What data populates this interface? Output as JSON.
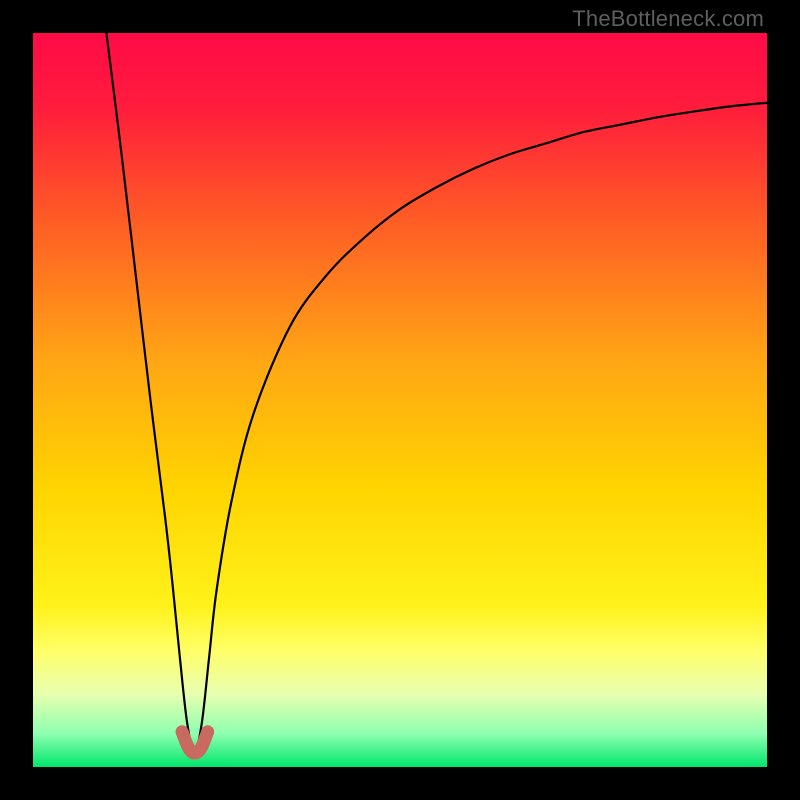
{
  "watermark": {
    "text": "TheBottleneck.com"
  },
  "chart_data": {
    "type": "line",
    "title": "",
    "xlabel": "",
    "ylabel": "",
    "xlim": [
      0,
      100
    ],
    "ylim": [
      0,
      100
    ],
    "grid": false,
    "legend": false,
    "gradient_stops": [
      {
        "offset": 0.0,
        "color": "#ff0b47"
      },
      {
        "offset": 0.1,
        "color": "#ff1c3c"
      },
      {
        "offset": 0.25,
        "color": "#ff5a26"
      },
      {
        "offset": 0.45,
        "color": "#ffa714"
      },
      {
        "offset": 0.62,
        "color": "#ffd400"
      },
      {
        "offset": 0.78,
        "color": "#fff21a"
      },
      {
        "offset": 0.84,
        "color": "#ffff66"
      },
      {
        "offset": 0.9,
        "color": "#e8ffb0"
      },
      {
        "offset": 0.955,
        "color": "#8dffb0"
      },
      {
        "offset": 1.0,
        "color": "#00e66b"
      }
    ],
    "optimum_x": 22,
    "series": [
      {
        "name": "bottleneck-curve",
        "x": [
          10,
          12,
          14,
          16,
          18,
          19,
          20,
          21,
          22,
          23,
          24,
          25,
          27,
          30,
          35,
          40,
          45,
          50,
          55,
          60,
          65,
          70,
          75,
          80,
          85,
          90,
          95,
          100
        ],
        "y": [
          100,
          84,
          67,
          50,
          34,
          25,
          15,
          6,
          2,
          6,
          15,
          24,
          36,
          48,
          60,
          67,
          72,
          76,
          79,
          81.5,
          83.5,
          85,
          86.5,
          87.5,
          88.5,
          89.3,
          90,
          90.5
        ]
      }
    ],
    "marker": {
      "name": "optimum-marker",
      "color": "#c96a60",
      "points": [
        {
          "x": 20.3,
          "y": 4.8
        },
        {
          "x": 21.2,
          "y": 2.6
        },
        {
          "x": 22.0,
          "y": 1.9
        },
        {
          "x": 22.9,
          "y": 2.6
        },
        {
          "x": 23.8,
          "y": 4.8
        }
      ]
    }
  }
}
